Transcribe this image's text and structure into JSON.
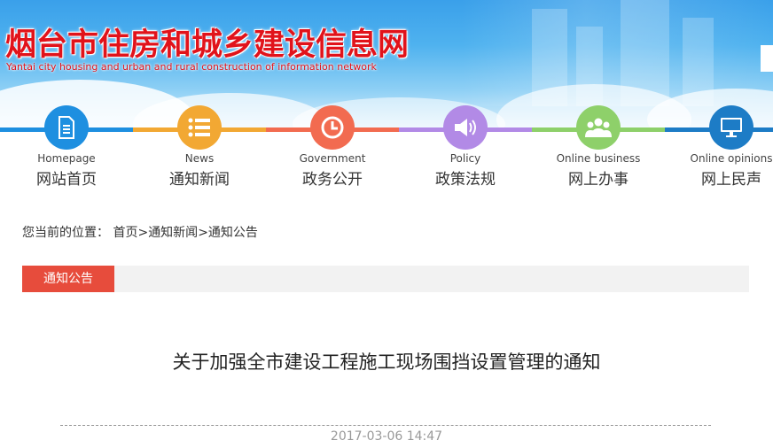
{
  "header": {
    "title": "烟台市住房和城乡建设信息网",
    "subtitle": "Yantai city housing and urban and rural construction of information network"
  },
  "nav": {
    "items": [
      {
        "en": "Homepage",
        "cn": "网站首页",
        "icon": "document-icon",
        "color": "#1e8fe0",
        "line": "#1e8fe0"
      },
      {
        "en": "News",
        "cn": "通知新闻",
        "icon": "list-icon",
        "color": "#f2a833",
        "line": "#f2a833"
      },
      {
        "en": "Government",
        "cn": "政务公开",
        "icon": "clock-icon",
        "color": "#f26b50",
        "line": "#f26b50"
      },
      {
        "en": "Policy",
        "cn": "政策法规",
        "icon": "speaker-icon",
        "color": "#b28ae6",
        "line": "#b28ae6"
      },
      {
        "en": "Online business",
        "cn": "网上办事",
        "icon": "people-icon",
        "color": "#8ed06a",
        "line": "#8ed06a"
      },
      {
        "en": "Online opinions",
        "cn": "网上民声",
        "icon": "monitor-icon",
        "color": "#1d7cc6",
        "line": "#1d7cc6"
      }
    ]
  },
  "breadcrumb": {
    "prefix": "您当前的位置：",
    "items": [
      "首页",
      "通知新闻",
      "通知公告"
    ],
    "separator": ">"
  },
  "section": {
    "label": "通知公告",
    "accent": "#e74c3c"
  },
  "article": {
    "title": "关于加强全市建设工程施工现场围挡设置管理的通知",
    "date": "2017-03-06 14:47"
  }
}
